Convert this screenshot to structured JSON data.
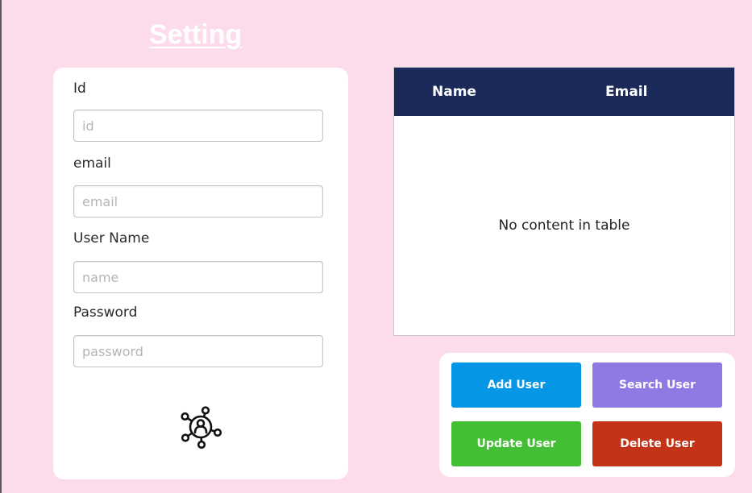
{
  "page": {
    "title": "Setting"
  },
  "form": {
    "fields": [
      {
        "label": "Id",
        "placeholder": "id",
        "value": ""
      },
      {
        "label": "email",
        "placeholder": "email",
        "value": ""
      },
      {
        "label": "User Name",
        "placeholder": "name",
        "value": ""
      },
      {
        "label": "Password",
        "placeholder": "password",
        "value": ""
      }
    ],
    "logo_icon": "network-user-icon"
  },
  "table": {
    "columns": [
      "Name",
      "Email"
    ],
    "rows": [],
    "empty_message": "No content in table",
    "header_color": "#1b2a58"
  },
  "actions": {
    "add": {
      "label": "Add User",
      "color": "#0596e6"
    },
    "search": {
      "label": "Search User",
      "color": "#8e7ae2"
    },
    "update": {
      "label": "Update User",
      "color": "#44bf35"
    },
    "delete": {
      "label": "Delete User",
      "color": "#c23317"
    }
  }
}
